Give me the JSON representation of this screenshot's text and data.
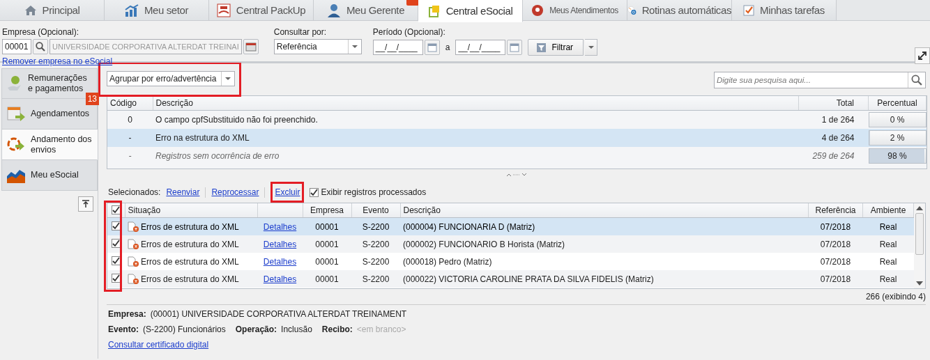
{
  "tabs": [
    {
      "label": "Principal",
      "selected": false,
      "notified": false
    },
    {
      "label": "Meu setor",
      "selected": false,
      "notified": false
    },
    {
      "label": "Central PackUp",
      "selected": false,
      "notified": false
    },
    {
      "label": "Meu Gerente",
      "selected": false,
      "notified": true
    },
    {
      "label": "Central eSocial",
      "selected": true,
      "notified": false
    },
    {
      "label": "Meus Atendimentos",
      "selected": false,
      "notified": false
    },
    {
      "label": "Rotinas automáticas",
      "selected": false,
      "notified": false
    },
    {
      "label": "Minhas tarefas",
      "selected": false,
      "notified": false
    }
  ],
  "filters": {
    "empresa": {
      "label": "Empresa (Opcional):",
      "code": "00001",
      "name": "UNIVERSIDADE CORPORATIVA ALTERDAT TREINAI"
    },
    "consultar": {
      "label": "Consultar por:",
      "value": "Referência"
    },
    "periodo": {
      "label": "Período (Opcional):",
      "from": "__/__/____",
      "separator": "a",
      "to": "__/__/____"
    },
    "filter_button": "Filtrar",
    "remove_link": "Remover empresa no eSocial"
  },
  "sidebar": {
    "items": [
      {
        "label": "Remunerações e pagamentos",
        "selected": false
      },
      {
        "label": "Agendamentos",
        "selected": false,
        "badge": "13"
      },
      {
        "label": "Andamento dos envios",
        "selected": true
      },
      {
        "label": "Meu eSocial",
        "selected": false
      }
    ]
  },
  "group_select": {
    "value": "Agrupar por erro/advertência"
  },
  "search": {
    "placeholder": "Digite sua pesquisa aqui..."
  },
  "summary": {
    "columns": [
      "Código",
      "Descrição",
      "Total",
      "Percentual"
    ],
    "rows": [
      {
        "code": "0",
        "description": "O campo cpfSubstituido não foi preenchido.",
        "total": "1 de 264",
        "percent": "0 %",
        "level": 0.0,
        "selected": false,
        "italic": false
      },
      {
        "code": "-",
        "description": "Erro na estrutura do XML",
        "total": "4 de 264",
        "percent": "2 %",
        "level": 0.02,
        "selected": true,
        "italic": false
      },
      {
        "code": "-",
        "description": "Registros sem ocorrência de erro",
        "total": "259 de 264",
        "percent": "98 %",
        "level": 0.98,
        "selected": false,
        "italic": true
      }
    ]
  },
  "actions": {
    "label": "Selecionados:",
    "links": [
      "Reenviar",
      "Reprocessar",
      "Excluir"
    ],
    "show_processed": {
      "label": "Exibir registros processados",
      "checked": true
    }
  },
  "records": {
    "all_checked": true,
    "columns": [
      "Situação",
      "Empresa",
      "Evento",
      "Descrição",
      "Referência",
      "Ambiente"
    ],
    "rows": [
      {
        "checked": true,
        "selected": true,
        "status": "Erros de estrutura do XML",
        "link": "Detalhes",
        "empresa": "00001",
        "evento": "S-2200",
        "descricao": "(000004) FUNCIONARIA D (Matriz)",
        "referencia": "07/2018",
        "ambiente": "Real"
      },
      {
        "checked": true,
        "selected": false,
        "status": "Erros de estrutura do XML",
        "link": "Detalhes",
        "empresa": "00001",
        "evento": "S-2200",
        "descricao": "(000002) FUNCIONARIO B Horista (Matriz)",
        "referencia": "07/2018",
        "ambiente": "Real"
      },
      {
        "checked": true,
        "selected": false,
        "status": "Erros de estrutura do XML",
        "link": "Detalhes",
        "empresa": "00001",
        "evento": "S-2200",
        "descricao": "(000018) Pedro (Matriz)",
        "referencia": "07/2018",
        "ambiente": "Real"
      },
      {
        "checked": true,
        "selected": false,
        "status": "Erros de estrutura do XML",
        "link": "Detalhes",
        "empresa": "00001",
        "evento": "S-2200",
        "descricao": "(000022) VICTORIA CAROLINE PRATA DA SILVA FIDELIS (Matriz)",
        "referencia": "07/2018",
        "ambiente": "Real"
      }
    ],
    "count": "266 (exibindo 4)"
  },
  "details": {
    "lines": [
      [
        {
          "label": "Empresa:",
          "value": "(00001) UNIVERSIDADE CORPORATIVA ALTERDAT TREINAMENT",
          "muted": false
        }
      ],
      [
        {
          "label": "Evento:",
          "value": "(S-2200) Funcionários",
          "muted": false
        },
        {
          "label": "Operação:",
          "value": "Inclusão",
          "muted": false
        },
        {
          "label": "Recibo:",
          "value": "<em branco>",
          "muted": true
        }
      ]
    ],
    "link": "Consultar certificado digital"
  }
}
